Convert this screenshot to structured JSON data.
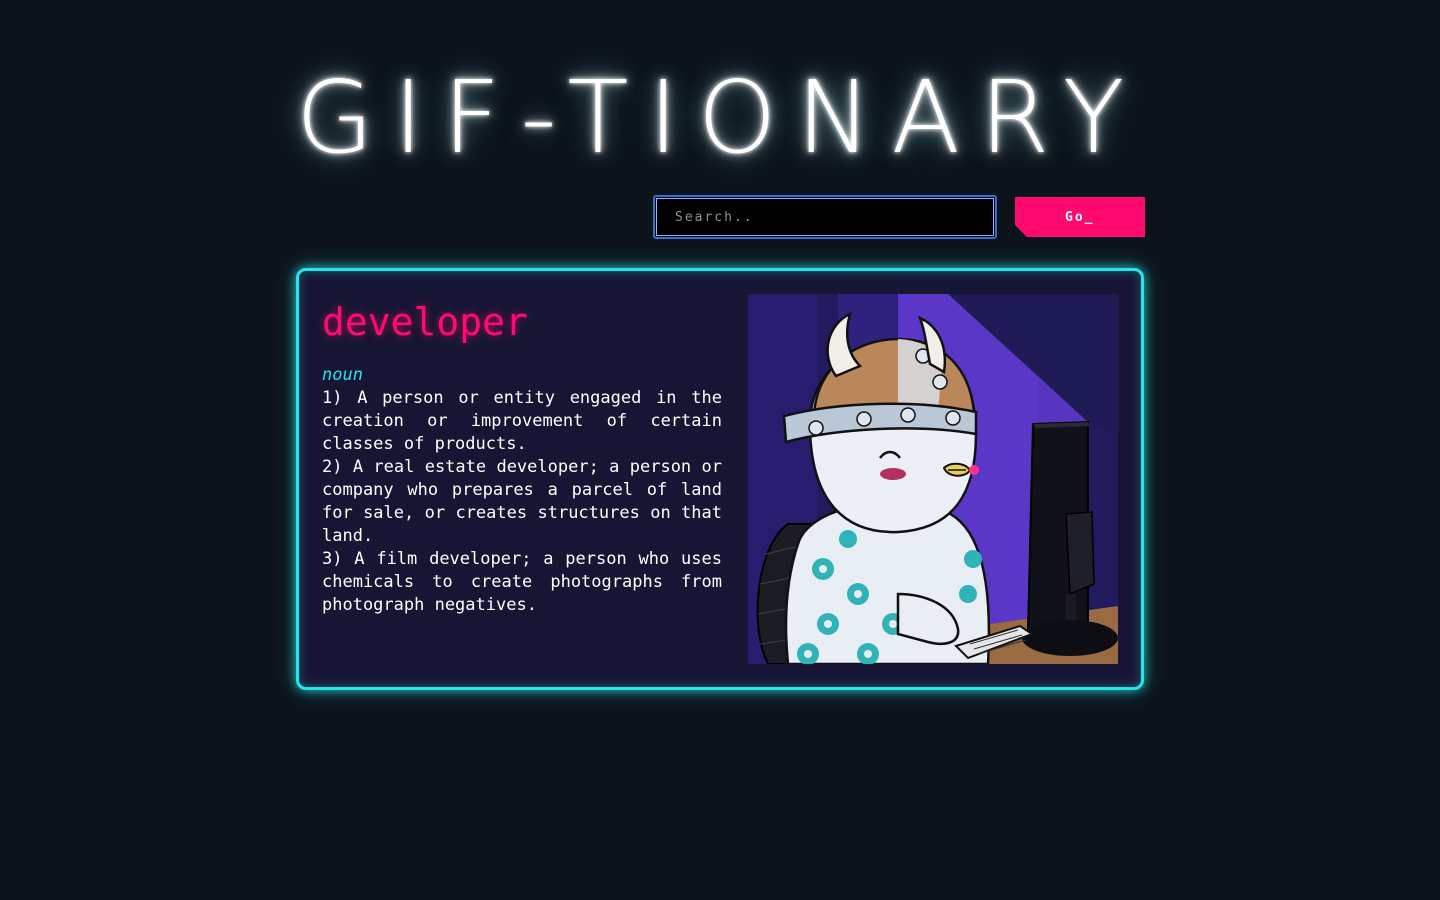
{
  "header": {
    "title": "GIF-TIONARY"
  },
  "search": {
    "placeholder": "Search..",
    "value": "",
    "button_label": "Go_"
  },
  "result": {
    "word": "developer",
    "part_of_speech": "noun",
    "definitions": [
      "1) A person or entity engaged in the creation or improvement of certain classes of products.",
      "2) A real estate developer; a person or company who prepares a parcel of land for sale, or creates structures on that land.",
      "3) A film developer; a person who uses chemicals to create photographs from photograph negatives."
    ]
  },
  "colors": {
    "background": "#0d131b",
    "accent_pink": "#ff0b6f",
    "accent_cyan": "#27e4ea",
    "card_background": "#161634"
  }
}
